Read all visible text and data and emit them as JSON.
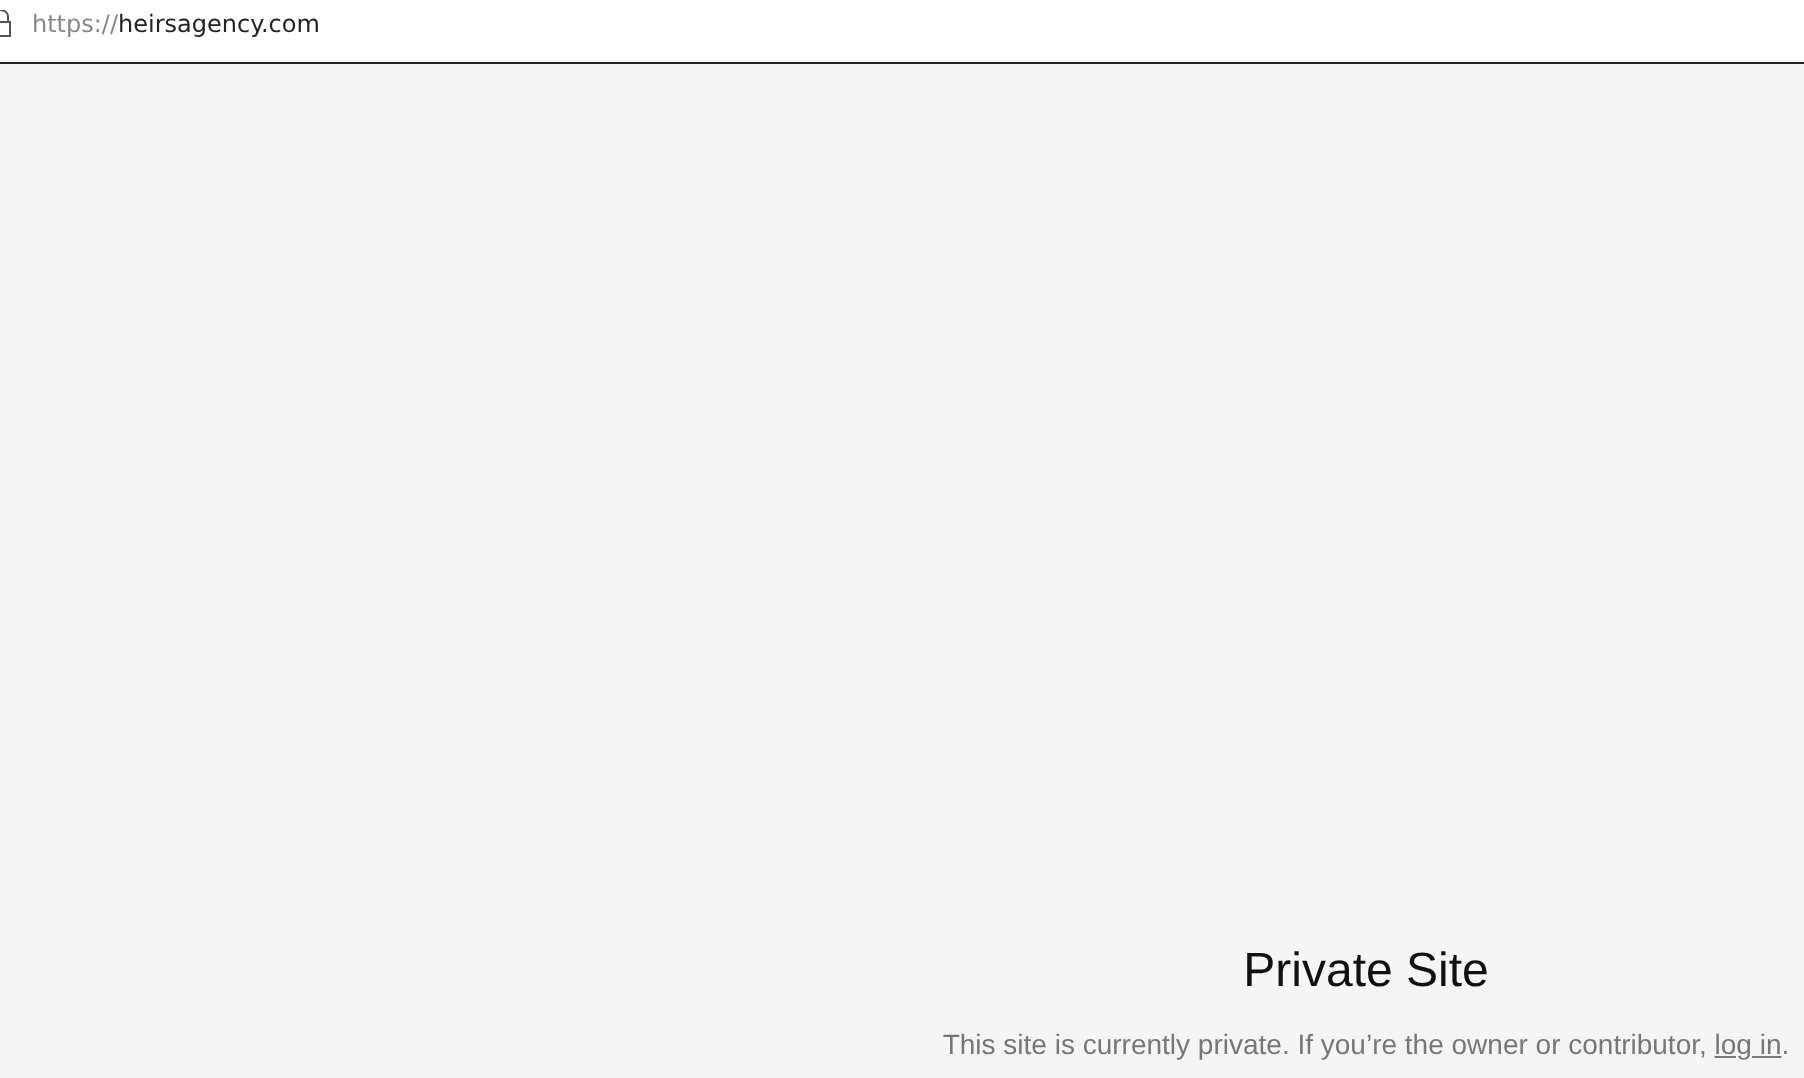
{
  "address_bar": {
    "scheme": "https://",
    "host": "heirsagency.com"
  },
  "page": {
    "title": "Private Site",
    "message": "This site is currently private. If you’re the owner or contributor, ",
    "link": "log in",
    "message_end": "."
  }
}
